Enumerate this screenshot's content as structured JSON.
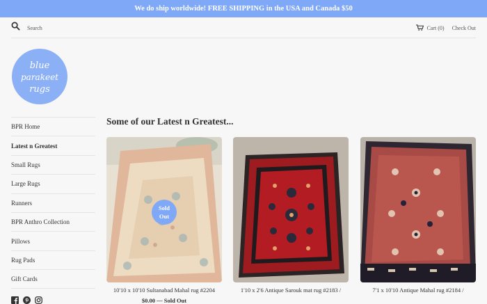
{
  "announcement": "We do ship worldwide! FREE SHIPPING in the USA and Canada $50",
  "header": {
    "search_placeholder": "Search",
    "cart_label": "Cart (0)",
    "checkout_label": "Check Out"
  },
  "logo": {
    "text": "blue parakeet rugs"
  },
  "sidebar": {
    "items": [
      {
        "label": "BPR Home"
      },
      {
        "label": "Latest n Greatest"
      },
      {
        "label": "Small Rugs"
      },
      {
        "label": "Large Rugs"
      },
      {
        "label": "Runners"
      },
      {
        "label": "BPR Anthro Collection"
      },
      {
        "label": "Pillows"
      },
      {
        "label": "Rug Pads"
      },
      {
        "label": "Gift Cards"
      }
    ]
  },
  "main": {
    "heading": "Some of our Latest n Greatest...",
    "products": [
      {
        "title": "10'10 x 10'10 Sultanabad Mahal rug #2204",
        "price": "$0.00 — Sold Out",
        "badge_line1": "Sold",
        "badge_line2": "Out"
      },
      {
        "title": "1'10 x 2'6 Antique Sarouk mat rug #2183 /",
        "price": ""
      },
      {
        "title": "7'1 x 10'10 Antique Mahal rug #2184 /",
        "price": ""
      }
    ]
  },
  "colors": {
    "accent": "#7fa8f7",
    "background": "#f7f7f7"
  },
  "icons": [
    "search-icon",
    "cart-icon",
    "facebook-icon",
    "pinterest-icon",
    "instagram-icon"
  ]
}
